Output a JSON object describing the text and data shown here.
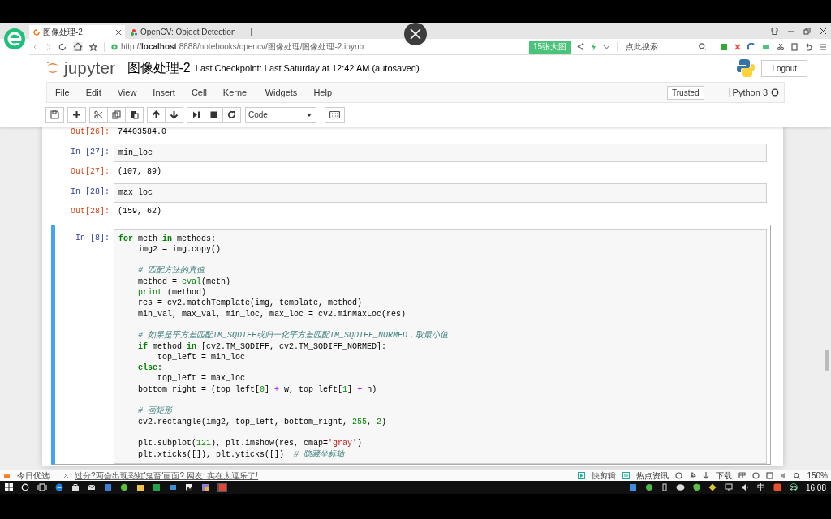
{
  "browser": {
    "tabs": [
      {
        "label": "图像处理-2",
        "selected": true
      },
      {
        "label": "OpenCV: Object Detection",
        "selected": false
      }
    ],
    "address": "http://**localhost**:8888/notebooks/opencv/图像处理/图像处理-2.ipynb",
    "badge": "15张大图",
    "search": {
      "placeholder": "点此搜索"
    }
  },
  "header": {
    "logo_text": "jupyter",
    "title": "图像处理-2",
    "checkpoint": "Last Checkpoint: Last Saturday at 12:42 AM (autosaved)",
    "logout": "Logout"
  },
  "menu": [
    "File",
    "Edit",
    "View",
    "Insert",
    "Cell",
    "Kernel",
    "Widgets",
    "Help"
  ],
  "trusted": "Trusted",
  "kernel": "Python 3",
  "cell_type": "Code",
  "rows": [
    {
      "kind": "output",
      "prompt": "Out[26]:",
      "text": "74403584.0"
    },
    {
      "kind": "input",
      "prompt": "In [27]:",
      "selected": false,
      "blocks": [
        [
          [
            {
              "t": "min_loc"
            }
          ]
        ]
      ]
    },
    {
      "kind": "output",
      "prompt": "Out[27]:",
      "text": "(107, 89)"
    },
    {
      "kind": "input",
      "prompt": "In [28]:",
      "selected": false,
      "blocks": [
        [
          [
            {
              "t": "max_loc"
            }
          ]
        ]
      ]
    },
    {
      "kind": "output",
      "prompt": "Out[28]:",
      "text": "(159, 62)"
    },
    {
      "kind": "input",
      "prompt": "In [8]:",
      "selected": true,
      "blocks": [
        [
          [
            {
              "t": "for",
              "kind": "keyword"
            },
            {
              "t": " meth "
            },
            {
              "t": "in",
              "kind": "keyword"
            },
            {
              "t": " methods:"
            }
          ],
          [
            {
              "t": "    img2 = img.copy()"
            }
          ]
        ],
        [
          [
            {
              "t": "    # 匹配方法的真值",
              "kind": "comment"
            }
          ],
          [
            {
              "t": "    method = "
            },
            {
              "t": "eval",
              "kind": "builtin"
            },
            {
              "t": "(meth)"
            }
          ],
          [
            {
              "t": "    print",
              "kind": "builtin"
            },
            {
              "t": " (method)"
            }
          ],
          [
            {
              "t": "    res = cv2.matchTemplate(img, template, method)"
            }
          ],
          [
            {
              "t": "    min_val, max_val, min_loc, max_loc = cv2.minMaxLoc(res)"
            }
          ]
        ],
        [
          [
            {
              "t": "    # 如果是平方差匹配TM_SQDIFF或归一化平方差匹配TM_SQDIFF_NORMED，取最小值",
              "kind": "comment"
            }
          ],
          [
            {
              "t": "    if",
              "kind": "keyword"
            },
            {
              "t": " method "
            },
            {
              "t": "in",
              "kind": "keyword"
            },
            {
              "t": " [cv2.TM_SQDIFF, cv2.TM_SQDIFF_NORMED]:"
            }
          ],
          [
            {
              "t": "        top_left = min_loc"
            }
          ],
          [
            {
              "t": "    else",
              "kind": "keyword"
            },
            {
              "t": ":"
            }
          ],
          [
            {
              "t": "        top_left = max_loc"
            }
          ],
          [
            {
              "t": "    bottom_right = (top_left["
            },
            {
              "t": "0",
              "kind": "number"
            },
            {
              "t": "] "
            },
            {
              "t": "+",
              "kind": "operator"
            },
            {
              "t": " w, top_left["
            },
            {
              "t": "1",
              "kind": "number"
            },
            {
              "t": "] "
            },
            {
              "t": "+",
              "kind": "operator"
            },
            {
              "t": " h)"
            }
          ]
        ],
        [
          [
            {
              "t": "    # 画矩形",
              "kind": "comment"
            }
          ],
          [
            {
              "t": "    cv2.rectangle(img2, top_left, bottom_right, "
            },
            {
              "t": "255",
              "kind": "number"
            },
            {
              "t": ", "
            },
            {
              "t": "2",
              "kind": "number"
            },
            {
              "t": ")"
            }
          ]
        ],
        [
          [
            {
              "t": "    plt.subplot("
            },
            {
              "t": "121",
              "kind": "number"
            },
            {
              "t": "), plt.imshow(res, cmap="
            },
            {
              "t": "'gray'",
              "kind": "string"
            },
            {
              "t": ")"
            }
          ],
          [
            {
              "t": "    plt.xticks([]), plt.yticks([])  "
            },
            {
              "t": "# 隐藏坐标轴",
              "kind": "comment"
            }
          ]
        ]
      ]
    }
  ],
  "status_bar": {
    "label": "今日优选",
    "news": "过分?两会出现彩虹'鬼畜'画面? 网友: 实在太逗乐了!",
    "items": [
      "快剪辑",
      "热点资讯"
    ],
    "download": "下载",
    "zoom": "150%"
  },
  "taskbar": {
    "badge": "25",
    "ime": "中",
    "time": "16:08"
  }
}
